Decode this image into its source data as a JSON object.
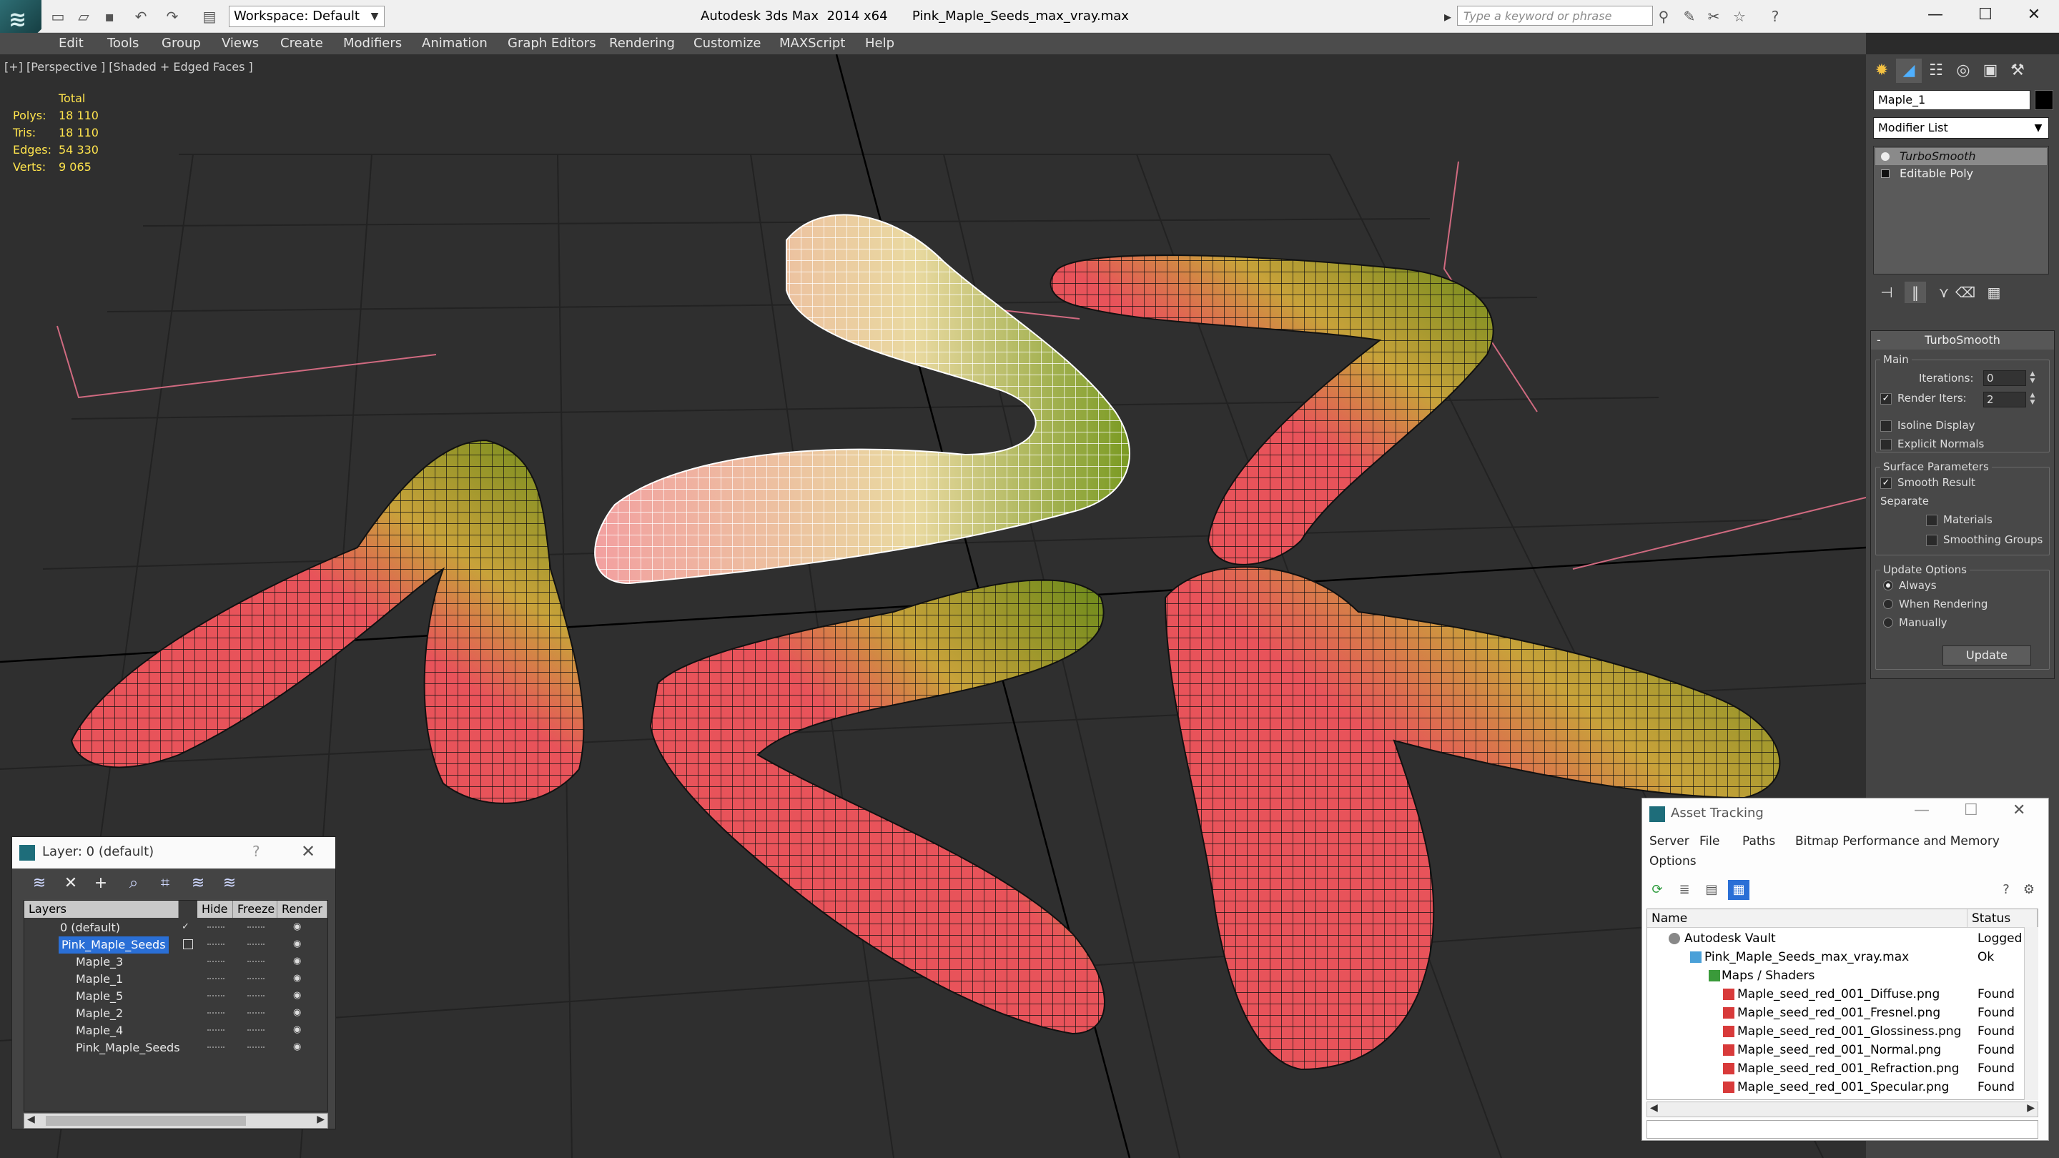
{
  "titlebar": {
    "workspace": "Workspace: Default",
    "app_title": "Autodesk 3ds Max  2014 x64",
    "file_title": "Pink_Maple_Seeds_max_vray.max",
    "search_placeholder": "Type a keyword or phrase"
  },
  "menu": [
    "Edit",
    "Tools",
    "Group",
    "Views",
    "Create",
    "Modifiers",
    "Animation",
    "Graph Editors",
    "Rendering",
    "Customize",
    "MAXScript",
    "Help"
  ],
  "viewport": {
    "label": "[+] [Perspective ] [Shaded + Edged Faces ]",
    "stats_header": "Total",
    "stats": [
      {
        "key": "Polys:",
        "value": "18 110"
      },
      {
        "key": "Tris:",
        "value": "18 110"
      },
      {
        "key": "Edges:",
        "value": "54 330"
      },
      {
        "key": "Verts:",
        "value": "9 065"
      }
    ]
  },
  "command_panel": {
    "object_name": "Maple_1",
    "modifier_list": "Modifier List",
    "stack": [
      "TurboSmooth",
      "Editable Poly"
    ],
    "rollout_title": "TurboSmooth",
    "main_group": "Main",
    "iterations_label": "Iterations:",
    "iterations_value": "0",
    "render_iters_label": "Render Iters:",
    "render_iters_value": "2",
    "isoline_display": "Isoline Display",
    "explicit_normals": "Explicit Normals",
    "surface_group": "Surface Parameters",
    "smooth_result": "Smooth Result",
    "separate": "Separate",
    "materials": "Materials",
    "smoothing_groups": "Smoothing Groups",
    "update_group": "Update Options",
    "always": "Always",
    "when_rendering": "When Rendering",
    "manually": "Manually",
    "update_button": "Update"
  },
  "layer_panel": {
    "title": "Layer: 0 (default)",
    "help": "?",
    "columns": [
      "Layers",
      "Hide",
      "Freeze",
      "Render"
    ],
    "rows": [
      "0 (default)",
      "Pink_Maple_Seeds",
      "Maple_3",
      "Maple_1",
      "Maple_5",
      "Maple_2",
      "Maple_4",
      "Pink_Maple_Seeds"
    ]
  },
  "asset_panel": {
    "title": "Asset Tracking",
    "menu": [
      "Server",
      "File",
      "Paths",
      "Bitmap Performance and Memory",
      "Options"
    ],
    "columns": [
      "Name",
      "Status"
    ],
    "rows": [
      {
        "name": "Autodesk Vault",
        "status": "Logged"
      },
      {
        "name": "Pink_Maple_Seeds_max_vray.max",
        "status": "Ok"
      },
      {
        "name": "Maps / Shaders",
        "status": ""
      },
      {
        "name": "Maple_seed_red_001_Diffuse.png",
        "status": "Found"
      },
      {
        "name": "Maple_seed_red_001_Fresnel.png",
        "status": "Found"
      },
      {
        "name": "Maple_seed_red_001_Glossiness.png",
        "status": "Found"
      },
      {
        "name": "Maple_seed_red_001_Normal.png",
        "status": "Found"
      },
      {
        "name": "Maple_seed_red_001_Refraction.png",
        "status": "Found"
      },
      {
        "name": "Maple_seed_red_001_Specular.png",
        "status": "Found"
      }
    ]
  },
  "colors": {
    "seed_red": "#e8535a",
    "seed_green": "#6a8a1a",
    "stats_yellow": "#ffe44d",
    "selection_blue": "#2a6fd6"
  }
}
